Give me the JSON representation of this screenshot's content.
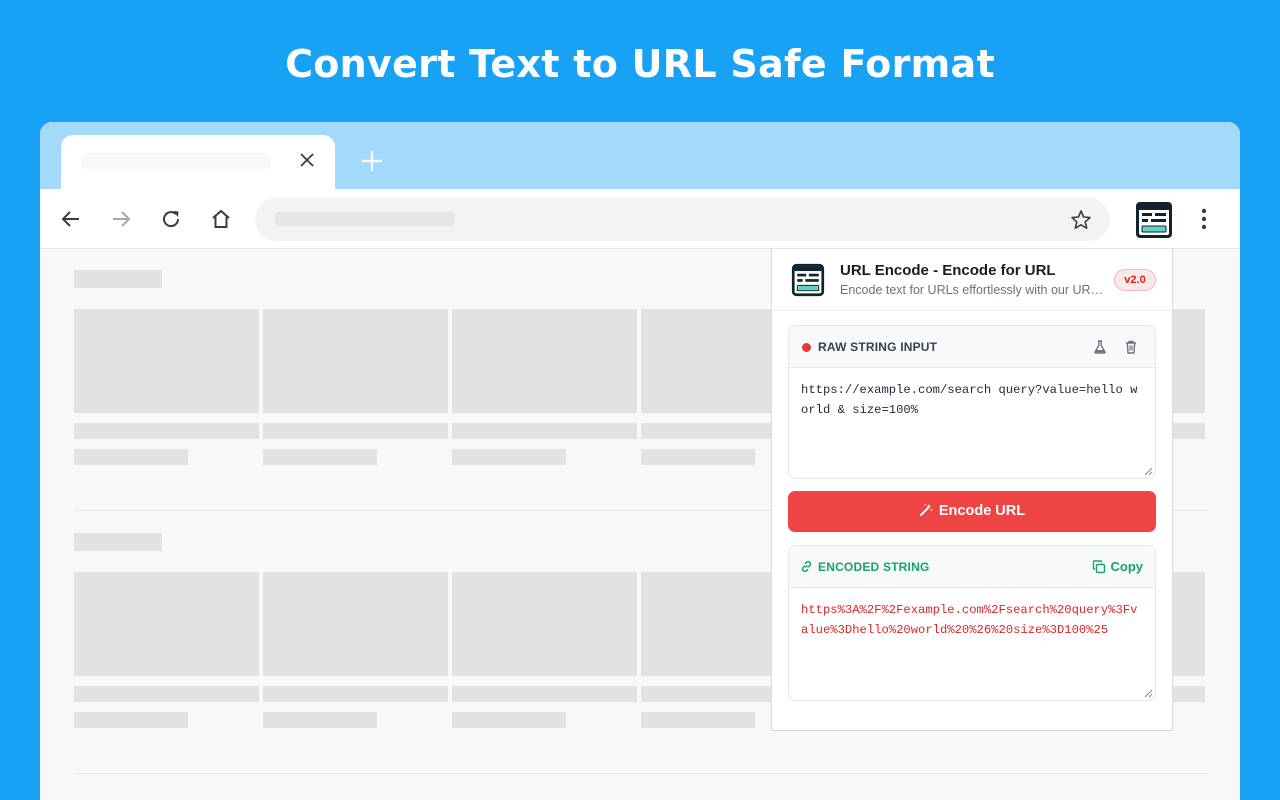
{
  "headline": "Convert Text to URL Safe Format",
  "icons": {
    "back": "arrow-left-icon",
    "forward": "arrow-right-icon",
    "reload": "reload-icon",
    "home": "home-icon",
    "star": "star-icon",
    "menu": "kebab-menu-icon",
    "close": "close-icon",
    "new_tab": "plus-icon",
    "sample": "flask-icon",
    "clear": "trash-icon",
    "wand": "magic-wand-icon",
    "link": "link-icon",
    "copy": "copy-icon"
  },
  "popup": {
    "title": "URL Encode - Encode for URL",
    "subtitle": "Encode text for URLs effortlessly with our URL Encode extension",
    "version": "v2.0",
    "input": {
      "label": "RAW STRING INPUT",
      "value": "https://example.com/search query?value=hello world & size=100%"
    },
    "encode_button": "Encode URL",
    "output": {
      "label": "ENCODED STRING",
      "copy_label": "Copy",
      "value": "https%3A%2F%2Fexample.com%2Fsearch%20query%3Fvalue%3Dhello%20world%20%26%20size%3D100%25"
    }
  },
  "colors": {
    "background": "#17a2f5",
    "tabstrip": "#a3d9fb",
    "accent_red": "#ef4444",
    "accent_green": "#19a463"
  }
}
